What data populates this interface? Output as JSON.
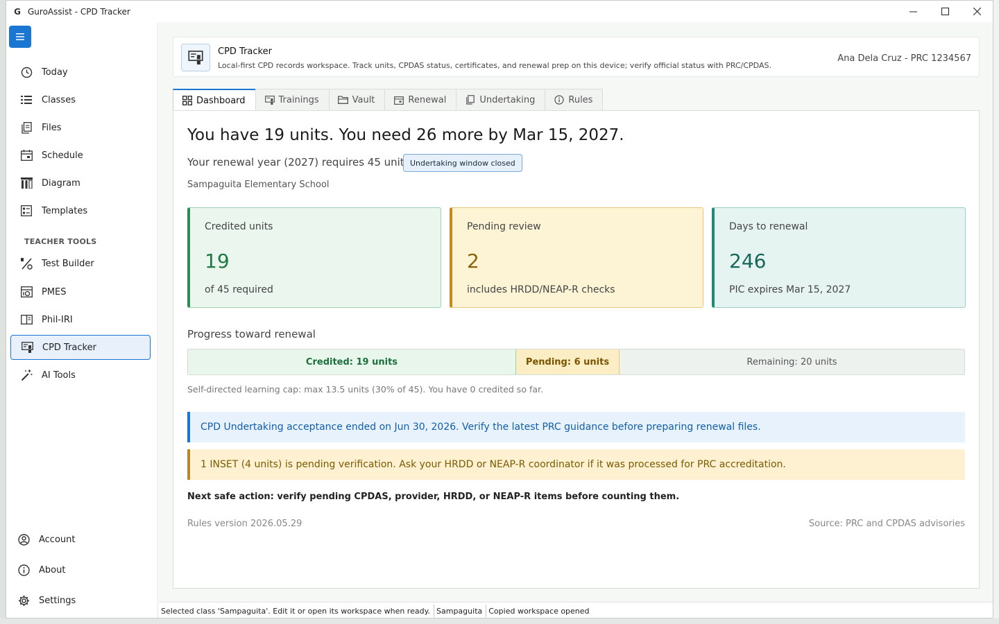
{
  "window": {
    "title": "GuroAssist - CPD Tracker",
    "logo_text": "G"
  },
  "sidebar": {
    "items": [
      {
        "label": "Today",
        "icon": "clock-icon"
      },
      {
        "label": "Classes",
        "icon": "list-icon"
      },
      {
        "label": "Files",
        "icon": "files-icon"
      },
      {
        "label": "Schedule",
        "icon": "calendar-icon"
      },
      {
        "label": "Diagram",
        "icon": "diagram-icon"
      },
      {
        "label": "Templates",
        "icon": "templates-icon"
      }
    ],
    "section_label": "TEACHER TOOLS",
    "tools": [
      {
        "label": "Test Builder",
        "icon": "percent-icon"
      },
      {
        "label": "PMES",
        "icon": "pmes-icon"
      },
      {
        "label": "Phil-IRI",
        "icon": "book-icon"
      },
      {
        "label": "CPD Tracker",
        "icon": "cpd-icon",
        "active": true
      },
      {
        "label": "AI Tools",
        "icon": "magic-wand-icon"
      }
    ],
    "bottom": [
      {
        "label": "Account",
        "icon": "account-icon"
      },
      {
        "label": "About",
        "icon": "info-icon"
      },
      {
        "label": "Settings",
        "icon": "gear-icon"
      }
    ]
  },
  "header": {
    "title": "CPD Tracker",
    "subtitle": "Local-first CPD records workspace. Track units, CPDAS status, certificates, and renewal prep on this device; verify official status with PRC/CPDAS.",
    "user": "Ana Dela Cruz - PRC 1234567"
  },
  "tabs": [
    {
      "label": "Dashboard",
      "icon": "grid-icon",
      "active": true
    },
    {
      "label": "Trainings",
      "icon": "cpd-icon"
    },
    {
      "label": "Vault",
      "icon": "folder-icon"
    },
    {
      "label": "Renewal",
      "icon": "calendar-icon"
    },
    {
      "label": "Undertaking",
      "icon": "files-icon"
    },
    {
      "label": "Rules",
      "icon": "info-icon"
    }
  ],
  "dashboard": {
    "headline": "You have 19 units. You need 26 more by Mar 15, 2027.",
    "subline": "Your renewal year (2027) requires 45 units.",
    "badge": "Undertaking window closed",
    "school": "Sampaguita Elementary School",
    "stats": {
      "credited": {
        "label": "Credited units",
        "value": "19",
        "note": "of 45 required"
      },
      "pending": {
        "label": "Pending review",
        "value": "2",
        "note": "includes HRDD/NEAP-R checks"
      },
      "days": {
        "label": "Days to renewal",
        "value": "246",
        "note": "PIC expires Mar 15, 2027"
      }
    },
    "progress": {
      "title": "Progress toward renewal",
      "credited_label": "Credited: 19 units",
      "pending_label": "Pending: 6 units",
      "remaining_label": "Remaining: 20 units",
      "credited_units": 19,
      "pending_units": 6,
      "remaining_units": 20,
      "total_units": 45
    },
    "cap_note": "Self-directed learning cap: max 13.5 units (30% of 45). You have 0 credited so far.",
    "alert_info": "CPD Undertaking acceptance ended on Jun 30, 2026. Verify the latest PRC guidance before preparing renewal files.",
    "alert_warn": "1 INSET (4 units) is pending verification. Ask your HRDD or NEAP-R coordinator if it was processed for PRC accreditation.",
    "next_action": "Next safe action: verify pending CPDAS, provider, HRDD, or NEAP-R items before counting them.",
    "rules_version": "Rules version 2026.05.29",
    "rules_source": "Source: PRC and CPDAS advisories"
  },
  "statusbar": {
    "message": "Selected class 'Sampaguita'. Edit it or open its workspace when ready.",
    "class": "Sampaguita",
    "state": "Copied workspace opened"
  },
  "colors": {
    "accent": "#1976d2",
    "credited": "#2e8b57",
    "pending": "#c68a1c",
    "days": "#1f8a7a"
  }
}
